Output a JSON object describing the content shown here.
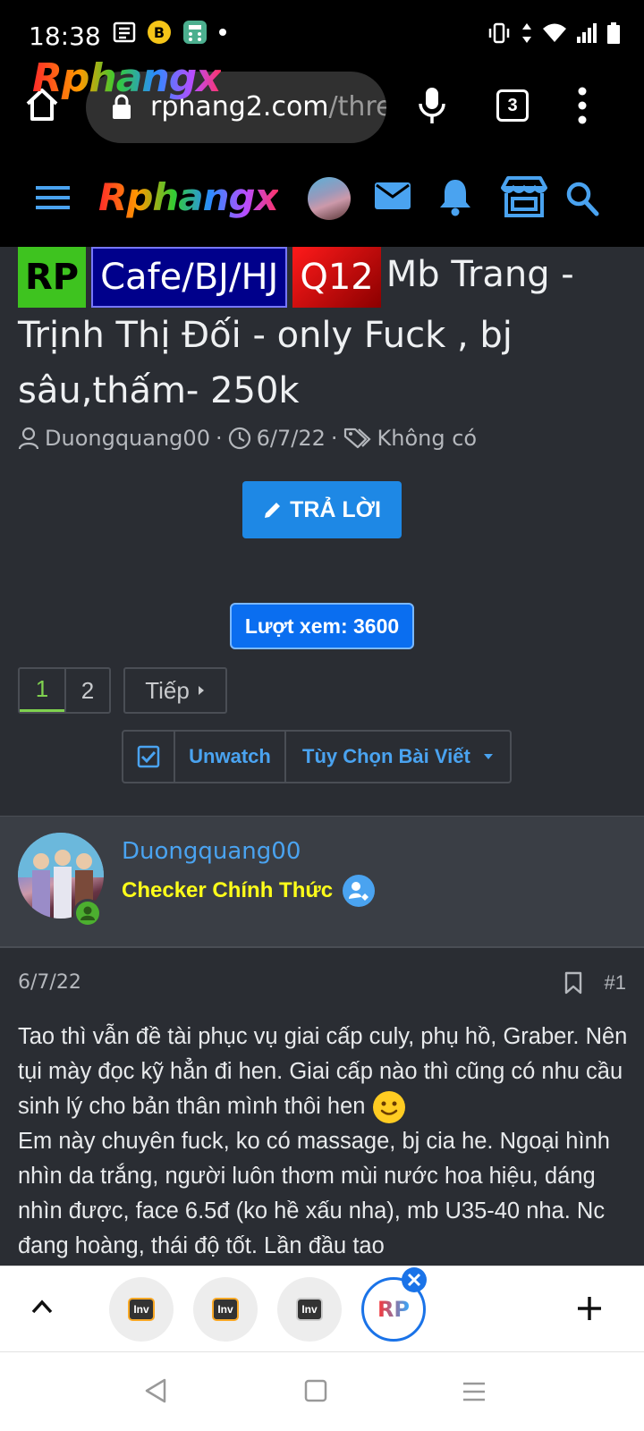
{
  "status_bar": {
    "time": "18:38"
  },
  "browser": {
    "brand_overlay": "Rphangx",
    "url_host": "rphang2.com",
    "url_path": "/thre",
    "tab_count": "3"
  },
  "site": {
    "logo": "Rphangx"
  },
  "thread": {
    "tags": [
      "RP",
      "Cafe/BJ/HJ",
      "Q12"
    ],
    "title": "Mb Trang - Trịnh Thị Đối - only Fuck , bj sâu,thấm- 250k",
    "author": "Duongquang00",
    "date": "6/7/22",
    "tags_text": "Không có",
    "reply_label": "TRẢ LỜI",
    "views_label": "Lượt xem: 3600"
  },
  "pagination": {
    "pages": [
      "1",
      "2"
    ],
    "next_label": "Tiếp"
  },
  "actions": {
    "unwatch_label": "Unwatch",
    "options_label": "Tùy Chọn Bài Viết"
  },
  "post": {
    "author_name": "Duongquang00",
    "author_title": "Checker Chính Thức",
    "date": "6/7/22",
    "number": "#1",
    "paragraph_1": "Tao thì vẫn đề tài phục vụ giai cấp culy, phụ hồ, Graber. Nên tụi mày đọc kỹ hẳn đi hen. Giai cấp nào thì cũng có nhu cầu sinh lý cho bản thân mình thôi hen",
    "paragraph_2": "Em này chuyên fuck, ko có massage, bj cia he. Ngoại hình nhìn da trắng, người luôn thơm mùi nước hoa hiệu, dáng nhìn được, face 6.5đ (ko hề xấu nha), mb U35-40 nha. Nc đang hoàng, thái độ tốt. Lần đầu tao"
  },
  "tabs": {
    "items": [
      {
        "label": "Inv",
        "icon": "inv-tab-icon"
      },
      {
        "label": "Inv",
        "icon": "inv-tab-icon"
      },
      {
        "label": "Inv",
        "icon": "inv-tab-icon"
      },
      {
        "label": "RP",
        "icon": "rp-tab-icon"
      }
    ]
  },
  "colors": {
    "accent_blue": "#1e88e5",
    "link_blue": "#4aa3f0",
    "checker_yellow": "#ffff1a",
    "page_bg": "#2a2d33",
    "active_page_green": "#7fd14f"
  }
}
